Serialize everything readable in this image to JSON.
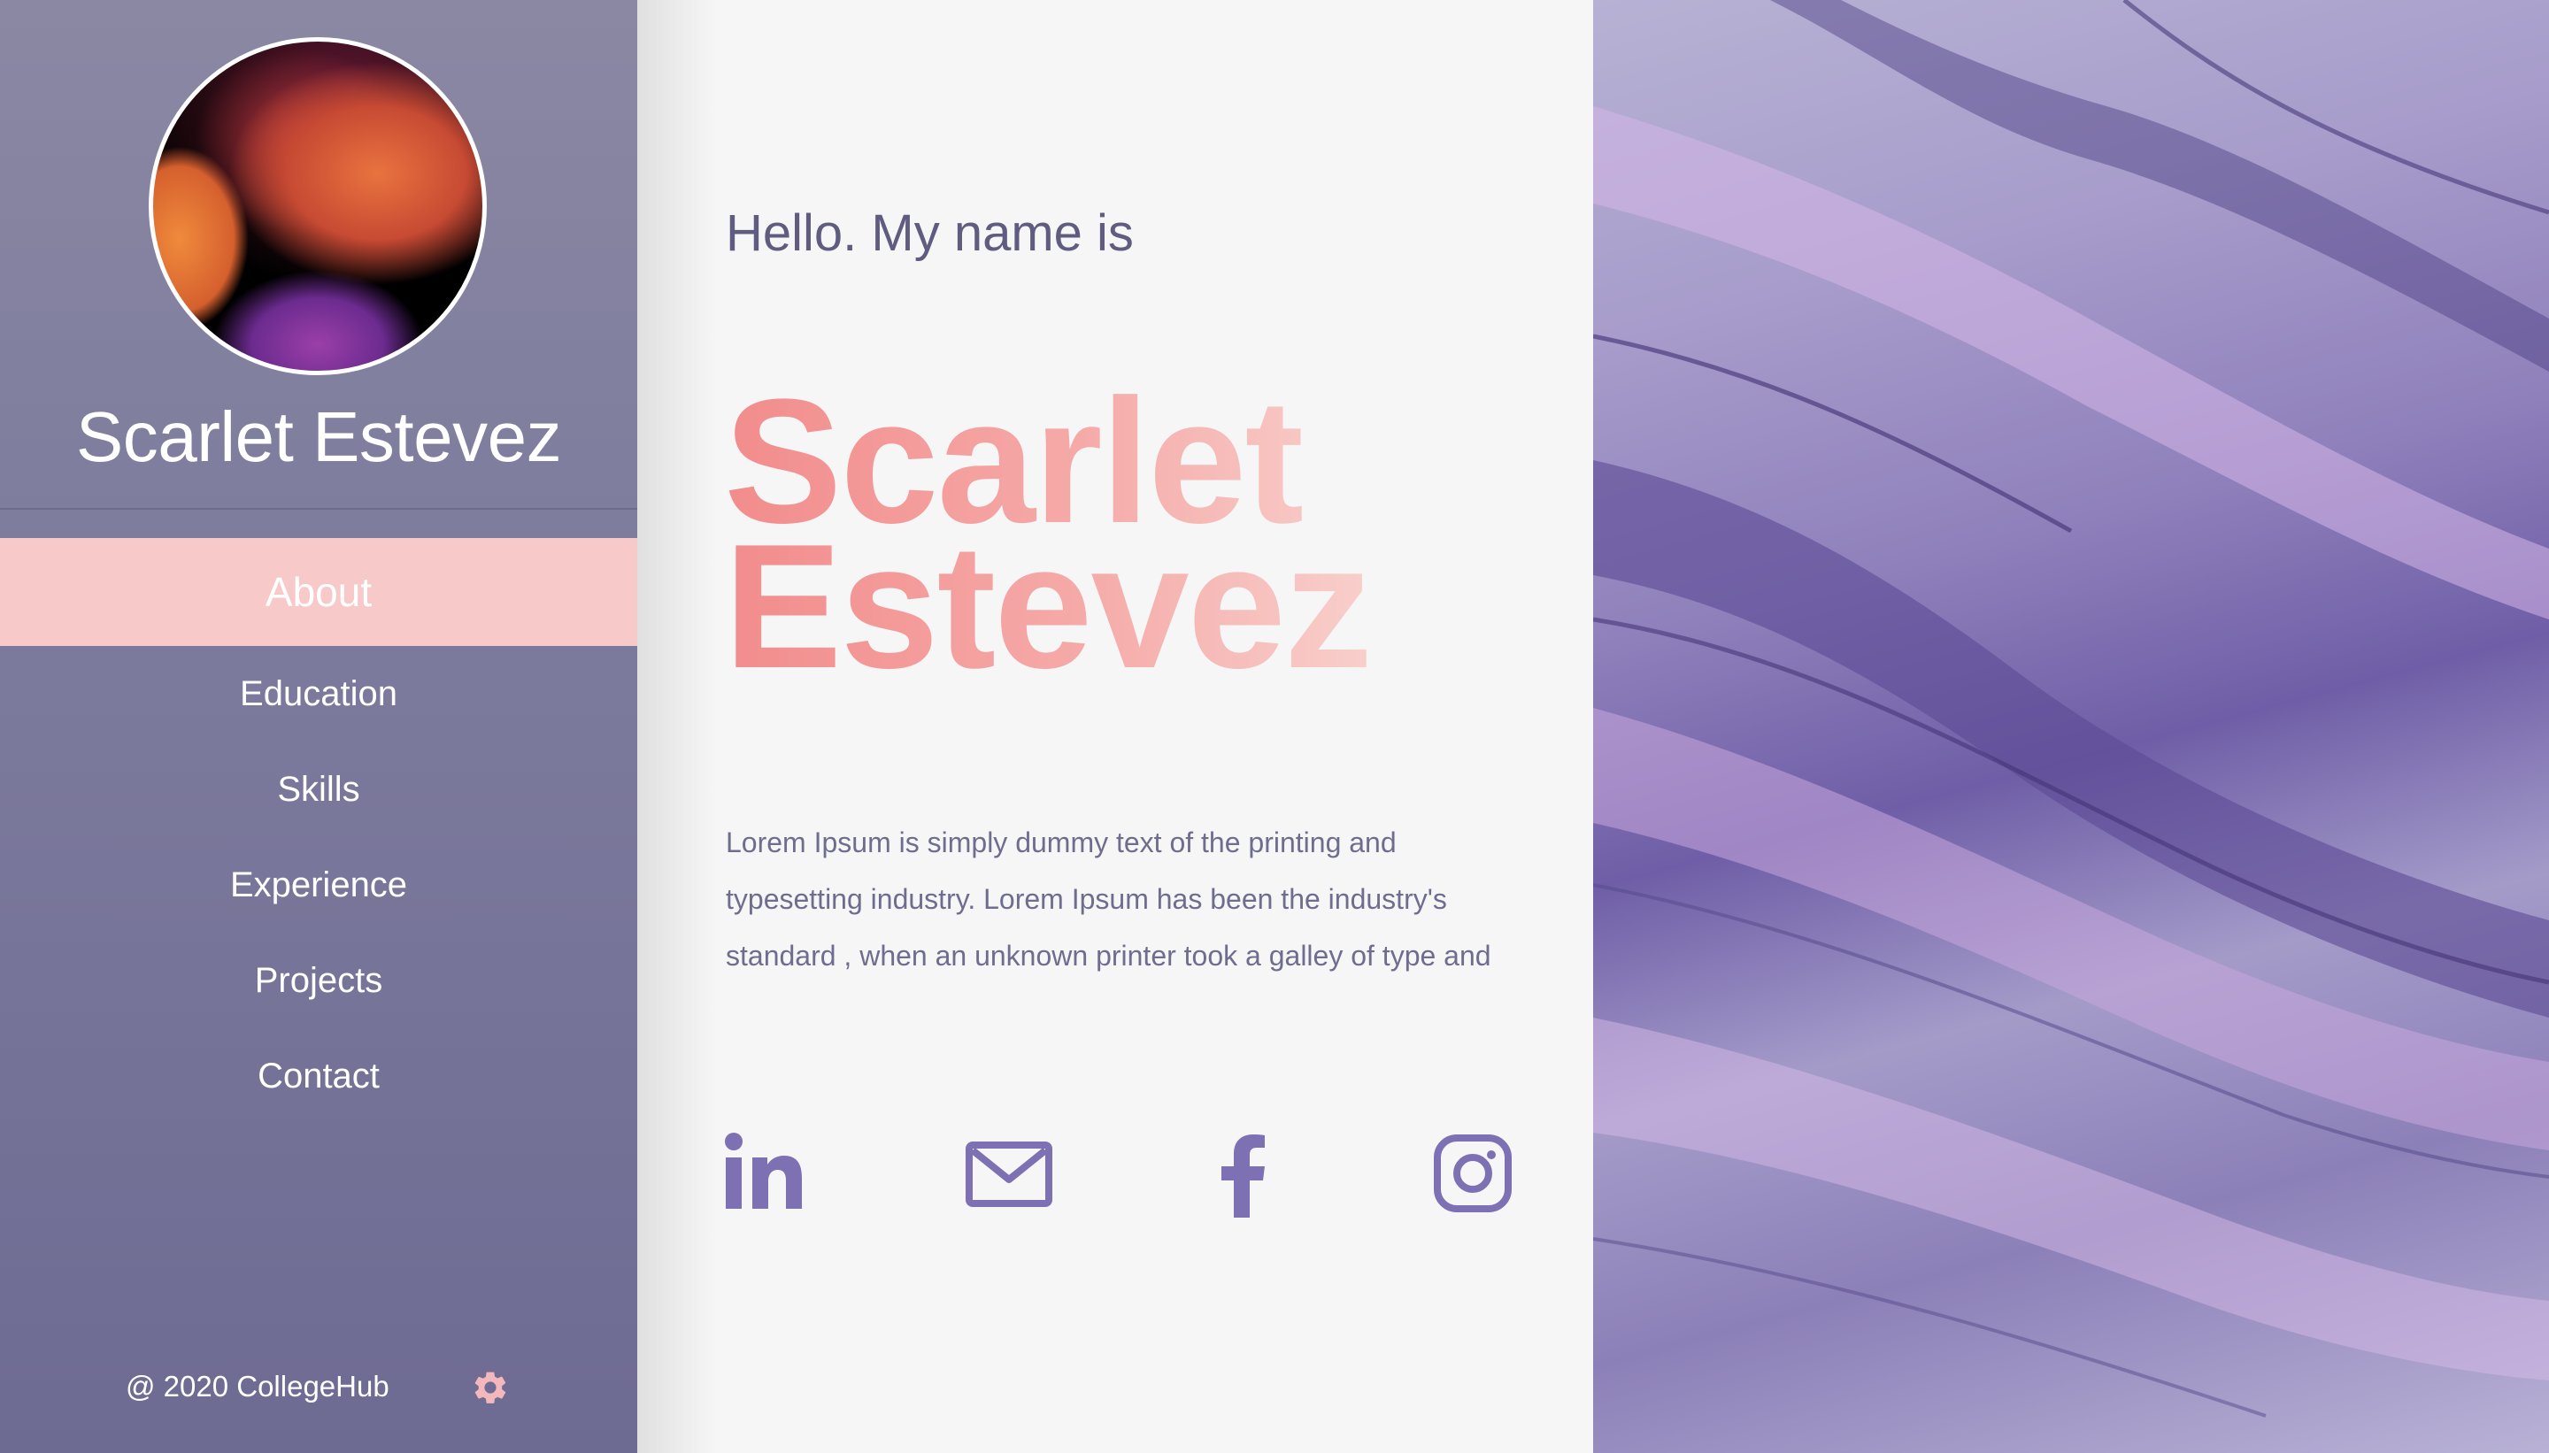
{
  "sidebar": {
    "name": "Scarlet Estevez",
    "nav": [
      {
        "label": "About",
        "active": true
      },
      {
        "label": "Education",
        "active": false
      },
      {
        "label": "Skills",
        "active": false
      },
      {
        "label": "Experience",
        "active": false
      },
      {
        "label": "Projects",
        "active": false
      },
      {
        "label": "Contact",
        "active": false
      }
    ],
    "footer": "@ 2020 CollegeHub",
    "settings_icon": "gear-icon"
  },
  "main": {
    "greeting": "Hello. My name is",
    "first_name": "Scarlet",
    "last_name": "Estevez",
    "bio": "Lorem Ipsum is simply dummy text of the printing and typesetting industry. Lorem Ipsum has been the industry's standard , when an unknown printer took a galley of type and",
    "social": [
      "linkedin-icon",
      "mail-icon",
      "facebook-icon",
      "instagram-icon"
    ]
  },
  "colors": {
    "sidebar": "#7c7a9c",
    "active_nav": "#f7c9c9",
    "accent_name": "#f28c8c",
    "icon": "#7d70b3",
    "text": "#6f6d8e"
  }
}
